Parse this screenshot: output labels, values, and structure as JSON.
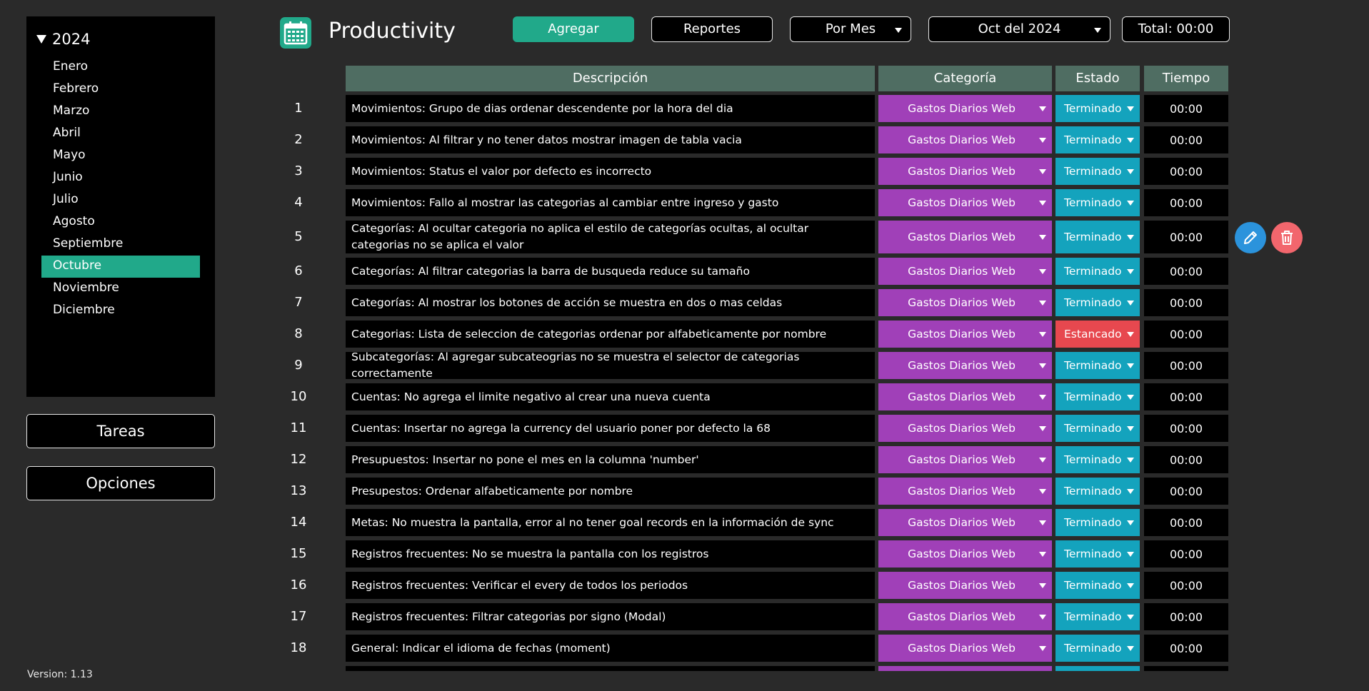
{
  "sidebar": {
    "year": "2024",
    "months": [
      "Enero",
      "Febrero",
      "Marzo",
      "Abril",
      "Mayo",
      "Junio",
      "Julio",
      "Agosto",
      "Septiembre",
      "Octubre",
      "Noviembre",
      "Diciembre"
    ],
    "active_month": "Octubre",
    "tareas_label": "Tareas",
    "opciones_label": "Opciones",
    "version": "Version: 1.13"
  },
  "header": {
    "title": "Productivity",
    "app_icon": "calendar-icon",
    "agregar_label": "Agregar",
    "reportes_label": "Reportes",
    "periodo_value": "Por Mes",
    "mes_value": "Oct del 2024",
    "total_label": "Total: 00:00"
  },
  "table": {
    "columns": [
      "Descripción",
      "Categoría",
      "Estado",
      "Tiempo"
    ],
    "rows": [
      {
        "num": "1",
        "desc": "Movimientos: Grupo de dias ordenar descendente por la hora del dia",
        "cat": "Gastos Diarios Web",
        "estado": "Terminado",
        "tiempo": "00:00"
      },
      {
        "num": "2",
        "desc": "Movimientos: Al filtrar y no tener datos mostrar imagen de tabla vacia",
        "cat": "Gastos Diarios Web",
        "estado": "Terminado",
        "tiempo": "00:00"
      },
      {
        "num": "3",
        "desc": "Movimientos: Status el valor por defecto es incorrecto",
        "cat": "Gastos Diarios Web",
        "estado": "Terminado",
        "tiempo": "00:00"
      },
      {
        "num": "4",
        "desc": "Movimientos: Fallo al mostrar las categorias al cambiar entre ingreso y gasto",
        "cat": "Gastos Diarios Web",
        "estado": "Terminado",
        "tiempo": "00:00"
      },
      {
        "num": "5",
        "desc": "Categorías: Al ocultar categoria no aplica el estilo de categorías ocultas, al ocultar categorias no se aplica el valor",
        "cat": "Gastos Diarios Web",
        "estado": "Terminado",
        "tiempo": "00:00",
        "tall": true
      },
      {
        "num": "6",
        "desc": "Categorías: Al filtrar categorias la barra de busqueda reduce su tamaño",
        "cat": "Gastos Diarios Web",
        "estado": "Terminado",
        "tiempo": "00:00"
      },
      {
        "num": "7",
        "desc": "Categorías: Al mostrar los botones de acción se muestra en dos o mas celdas",
        "cat": "Gastos Diarios Web",
        "estado": "Terminado",
        "tiempo": "00:00"
      },
      {
        "num": "8",
        "desc": "Categorias: Lista de seleccion de categorias ordenar por alfabeticamente por nombre",
        "cat": "Gastos Diarios Web",
        "estado": "Estancado",
        "tiempo": "00:00",
        "status_color": "#e7484f"
      },
      {
        "num": "9",
        "desc": "Subcategorías: Al agregar subcateogrias no se muestra el selector de categorias correctamente",
        "cat": "Gastos Diarios Web",
        "estado": "Terminado",
        "tiempo": "00:00"
      },
      {
        "num": "10",
        "desc": "Cuentas: No agrega el limite negativo al crear una nueva cuenta",
        "cat": "Gastos Diarios Web",
        "estado": "Terminado",
        "tiempo": "00:00"
      },
      {
        "num": "11",
        "desc": "Cuentas: Insertar no agrega la currency del usuario poner por defecto la 68",
        "cat": "Gastos Diarios Web",
        "estado": "Terminado",
        "tiempo": "00:00"
      },
      {
        "num": "12",
        "desc": "Presupuestos: Insertar no pone el mes en la columna 'number'",
        "cat": "Gastos Diarios Web",
        "estado": "Terminado",
        "tiempo": "00:00"
      },
      {
        "num": "13",
        "desc": "Presupestos: Ordenar alfabeticamente por nombre",
        "cat": "Gastos Diarios Web",
        "estado": "Terminado",
        "tiempo": "00:00"
      },
      {
        "num": "14",
        "desc": "Metas: No muestra la pantalla, error al no tener goal records en la información de sync",
        "cat": "Gastos Diarios Web",
        "estado": "Terminado",
        "tiempo": "00:00"
      },
      {
        "num": "15",
        "desc": "Registros frecuentes: No se muestra la pantalla con los registros",
        "cat": "Gastos Diarios Web",
        "estado": "Terminado",
        "tiempo": "00:00"
      },
      {
        "num": "16",
        "desc": "Registros frecuentes: Verificar el every de todos los periodos",
        "cat": "Gastos Diarios Web",
        "estado": "Terminado",
        "tiempo": "00:00"
      },
      {
        "num": "17",
        "desc": "Registros frecuentes: Filtrar categorias por signo (Modal)",
        "cat": "Gastos Diarios Web",
        "estado": "Terminado",
        "tiempo": "00:00"
      },
      {
        "num": "18",
        "desc": "General: Indicar el idioma de fechas (moment)",
        "cat": "Gastos Diarios Web",
        "estado": "Terminado",
        "tiempo": "00:00"
      }
    ],
    "row_actions": {
      "edit_icon": "pencil-icon",
      "delete_icon": "trash-icon"
    }
  },
  "colors": {
    "accent": "#21a98a",
    "category": "#a040b8",
    "status_done": "#14a3bd",
    "status_stalled": "#e7484f",
    "header_bg": "#4f6d62",
    "edit": "#2b93dc",
    "delete": "#f2666d"
  }
}
